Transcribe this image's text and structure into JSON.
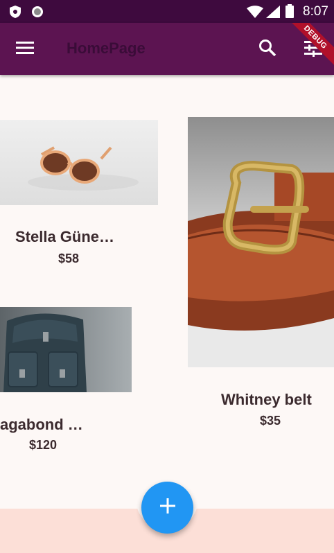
{
  "status_bar": {
    "time": "8:07",
    "left_icons": [
      "shield-icon",
      "circle-icon"
    ],
    "right_icons": [
      "wifi-icon",
      "signal-icon",
      "battery-icon"
    ]
  },
  "app_bar": {
    "title": "HomePage",
    "menu_icon": "menu-icon",
    "search_icon": "search-icon",
    "filter_icon": "tune-icon",
    "background": "#5c1451"
  },
  "debug_banner": "DEBUG",
  "products": [
    {
      "name": "Stella Güne…",
      "price": "$58"
    },
    {
      "name": "Whitney belt",
      "price": "$35"
    },
    {
      "name": "agabond …",
      "price": "$120"
    }
  ],
  "fab": {
    "icon": "add-icon",
    "color": "#2196f3"
  },
  "bottom_bar": {
    "color": "#fcdfd7"
  }
}
